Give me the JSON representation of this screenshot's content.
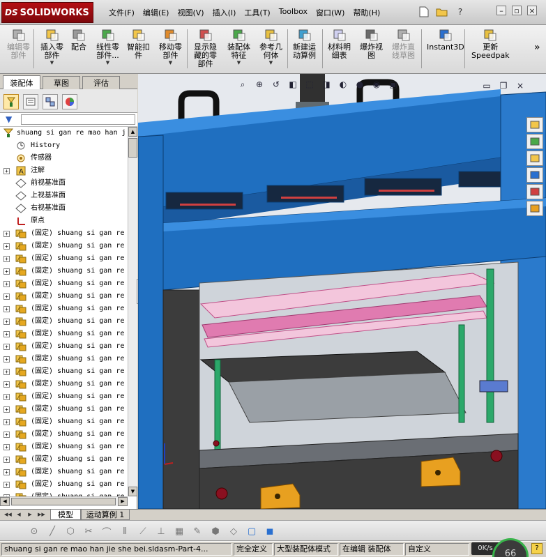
{
  "app": {
    "logo_text": "SOLIDWORKS",
    "logo_prefix": "DS"
  },
  "menu": [
    "文件(F)",
    "编辑(E)",
    "视图(V)",
    "插入(I)",
    "工具(T)",
    "Toolbox",
    "窗口(W)",
    "帮助(H)"
  ],
  "quick_access": [
    "new-document-icon",
    "open-icon",
    "help-icon"
  ],
  "window_controls": [
    "minimize-icon",
    "restore-icon",
    "close-icon"
  ],
  "ribbon": [
    {
      "label": "编辑零\n部件",
      "disabled": true,
      "dropdown": false,
      "icon": "edit-component-icon"
    },
    {
      "label": "插入零\n部件",
      "disabled": false,
      "dropdown": true,
      "icon": "insert-component-icon"
    },
    {
      "label": "配合",
      "disabled": false,
      "dropdown": false,
      "icon": "mate-icon"
    },
    {
      "label": "线性零\n部件...",
      "disabled": false,
      "dropdown": true,
      "icon": "linear-pattern-icon"
    },
    {
      "label": "智能扣\n件",
      "disabled": false,
      "dropdown": false,
      "icon": "smart-fasteners-icon"
    },
    {
      "label": "移动零\n部件",
      "disabled": false,
      "dropdown": true,
      "icon": "move-component-icon"
    },
    {
      "label": "显示隐\n藏的零\n部件",
      "disabled": false,
      "dropdown": false,
      "icon": "show-hidden-icon"
    },
    {
      "label": "装配体\n特征",
      "disabled": false,
      "dropdown": true,
      "icon": "assembly-features-icon"
    },
    {
      "label": "参考几\n何体",
      "disabled": false,
      "dropdown": true,
      "icon": "reference-geometry-icon"
    },
    {
      "label": "新建运\n动算例",
      "disabled": false,
      "dropdown": false,
      "icon": "new-motion-study-icon"
    },
    {
      "label": "材料明\n细表",
      "disabled": false,
      "dropdown": false,
      "icon": "bill-of-materials-icon"
    },
    {
      "label": "爆炸视\n图",
      "disabled": false,
      "dropdown": false,
      "icon": "exploded-view-icon"
    },
    {
      "label": "爆炸直\n线草图",
      "disabled": true,
      "dropdown": false,
      "icon": "explode-line-sketch-icon"
    },
    {
      "label": "Instant3D",
      "disabled": false,
      "dropdown": false,
      "icon": "instant3d-icon"
    },
    {
      "label": "更新\nSpeedpak",
      "disabled": false,
      "dropdown": false,
      "icon": "speedpak-icon"
    }
  ],
  "ribbon_more": "»",
  "feature_tabs": [
    "装配体",
    "草图",
    "评估"
  ],
  "manager_buttons": [
    "feature-manager-icon",
    "property-manager-icon",
    "configuration-manager-icon",
    "display-manager-icon"
  ],
  "tree": {
    "root": "shuang si gan re mao han j",
    "items": [
      {
        "label": "History",
        "icon": "history-icon",
        "expand": false
      },
      {
        "label": "传感器",
        "icon": "sensor-icon",
        "expand": false
      },
      {
        "label": "注解",
        "icon": "annotation-icon",
        "expand": true
      },
      {
        "label": "前视基准面",
        "icon": "plane-icon",
        "expand": false
      },
      {
        "label": "上视基准面",
        "icon": "plane-icon",
        "expand": false
      },
      {
        "label": "右视基准面",
        "icon": "plane-icon",
        "expand": false
      },
      {
        "label": "原点",
        "icon": "origin-icon",
        "expand": false
      }
    ],
    "component_label": "(固定) shuang si gan re",
    "component_count": 22
  },
  "heads_up": [
    "zoom-fit-icon",
    "zoom-area-icon",
    "previous-view-icon",
    "section-view-icon",
    "view-orientation-icon",
    "display-style-icon",
    "hide-show-icon",
    "edit-appearance-icon",
    "apply-scene-icon",
    "view-settings-icon"
  ],
  "task_pane": [
    "home-icon",
    "design-library-icon",
    "file-explorer-icon",
    "view-palette-icon",
    "appearances-icon",
    "custom-properties-icon"
  ],
  "bottom_tabs": [
    "模型",
    "运动算例 1"
  ],
  "sketch_tools": [
    "point-icon",
    "line-icon",
    "polygon-icon",
    "trim-icon",
    "offset-icon",
    "mirror-icon",
    "dimension-icon",
    "relation-icon",
    "grid-icon",
    "3d-sketch-icon",
    "part-icon",
    "reference-icon",
    "box-icon",
    "cube-icon"
  ],
  "status": {
    "filename": "shuang si gan re mao han jie she bei.sldasm-Part-4...",
    "definition": "完全定义",
    "mode": "大型装配体模式",
    "editing": "在编辑 装配体",
    "units": "自定义",
    "rate": "0K/s",
    "gauge": "66"
  },
  "colors": {
    "frame_blue": "#1f6fc0",
    "frame_blue_light": "#3a8ee0",
    "rail_pink": "#e07bb0",
    "mount_orange": "#e8a020",
    "motor_teal": "#1aa8a0",
    "dark_plate": "#3c3c3c"
  }
}
